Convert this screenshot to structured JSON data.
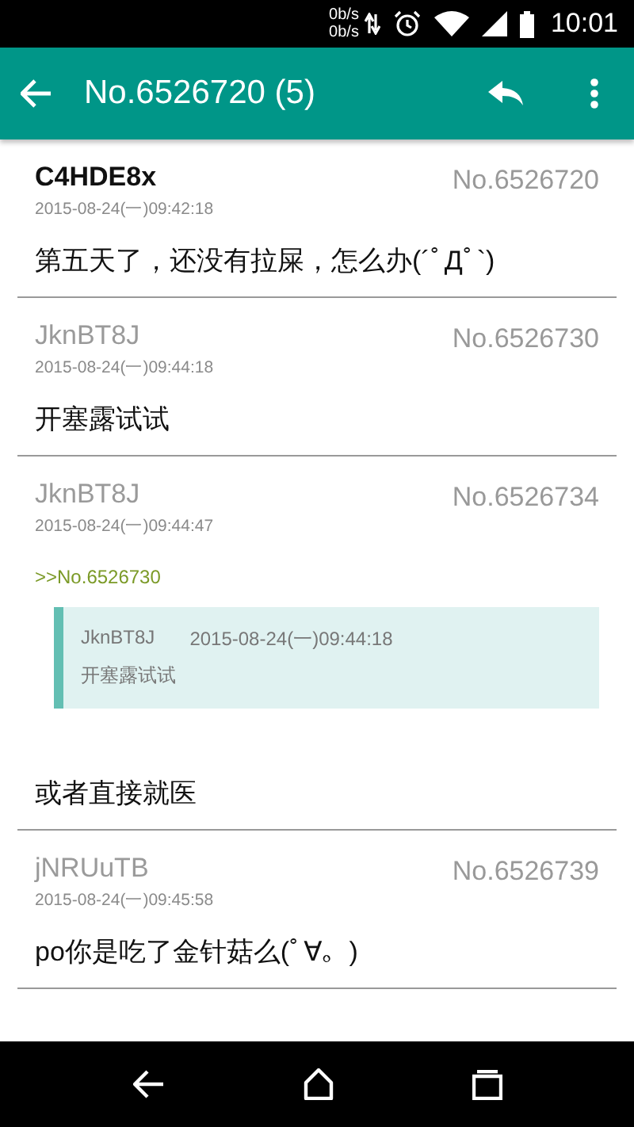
{
  "status_bar": {
    "net_up": "0b/s",
    "net_down": "0b/s",
    "time": "10:01"
  },
  "toolbar": {
    "title": "No.6526720 (5)"
  },
  "posts": [
    {
      "author": "C4HDE8x",
      "is_po": true,
      "date": "2015-08-24(一)09:42:18",
      "number": "No.6526720",
      "content": "第五天了，还没有拉屎，怎么办(´ﾟДﾟ`)"
    },
    {
      "author": "JknBT8J",
      "is_po": false,
      "date": "2015-08-24(一)09:44:18",
      "number": "No.6526730",
      "content": "开塞露试试"
    },
    {
      "author": "JknBT8J",
      "is_po": false,
      "date": "2015-08-24(一)09:44:47",
      "number": "No.6526734",
      "reply_ref": ">>No.6526730",
      "quote": {
        "author": "JknBT8J",
        "date": "2015-08-24(一)09:44:18",
        "content": "开塞露试试"
      },
      "content": "或者直接就医"
    },
    {
      "author": "jNRUuTB",
      "is_po": false,
      "date": "2015-08-24(一)09:45:58",
      "number": "No.6526739",
      "content": "po你是吃了金针菇么(ﾟ∀。)"
    }
  ]
}
